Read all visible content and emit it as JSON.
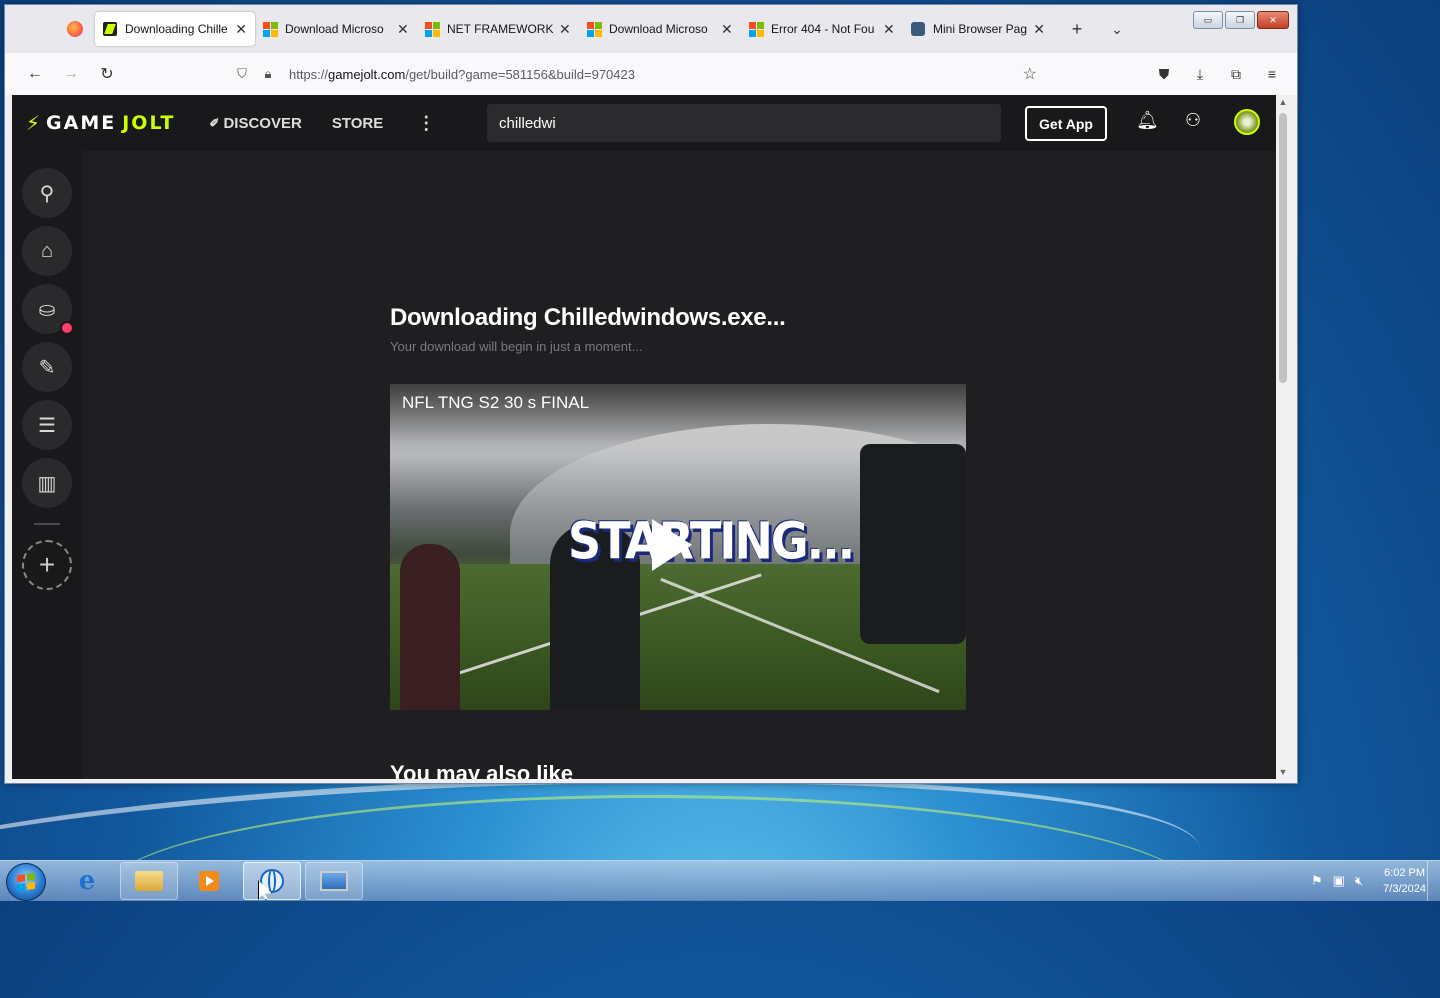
{
  "tabs": [
    {
      "title": "Downloading Chille",
      "favicon": "gamejolt-icon",
      "active": true
    },
    {
      "title": "Download Microso",
      "favicon": "microsoft-icon",
      "active": false
    },
    {
      "title": "NET FRAMEWORK",
      "favicon": "microsoft-icon",
      "active": false
    },
    {
      "title": "Download Microso",
      "favicon": "microsoft-icon",
      "active": false
    },
    {
      "title": "Error 404 - Not Fou",
      "favicon": "microsoft-icon",
      "active": false
    },
    {
      "title": "Mini Browser Page",
      "favicon": "mini-browser-icon",
      "active": false
    }
  ],
  "tab_controls": {
    "new_tab": "+",
    "list_all": "⌄"
  },
  "window_controls": {
    "minimize": "▭",
    "restore": "❐",
    "close": "✕"
  },
  "navbar": {
    "back": "←",
    "forward": "→",
    "reload": "↻",
    "url_prefix": "https://",
    "url_host": "gamejolt.com",
    "url_path": "/get/build?game=581156&build=970423",
    "bookmark": "☆"
  },
  "gamejolt": {
    "logo_game": "GAME",
    "logo_jolt": "JOLT",
    "nav_discover": "DISCOVER",
    "nav_store": "STORE",
    "nav_more": "⋮",
    "search_value": "chilledwi",
    "get_app": "Get App",
    "download_title": "Downloading Chilledwindows.exe...",
    "download_subtitle": "Your download will begin in just a moment...",
    "video_title": "NFL TNG S2 30 s FINAL",
    "video_overlay_text": "STARTING...",
    "also_like": "You may also like"
  },
  "sidebar_icons": [
    "explore-icon",
    "store-icon",
    "bag-icon",
    "trophy-icon",
    "chat-icon",
    "library-icon"
  ],
  "taskbar": {
    "time": "6:02 PM",
    "date": "7/3/2024"
  },
  "colors": {
    "accent": "#ccff00",
    "notification": "#ff3e6b",
    "page_bg": "#1f1f22"
  }
}
